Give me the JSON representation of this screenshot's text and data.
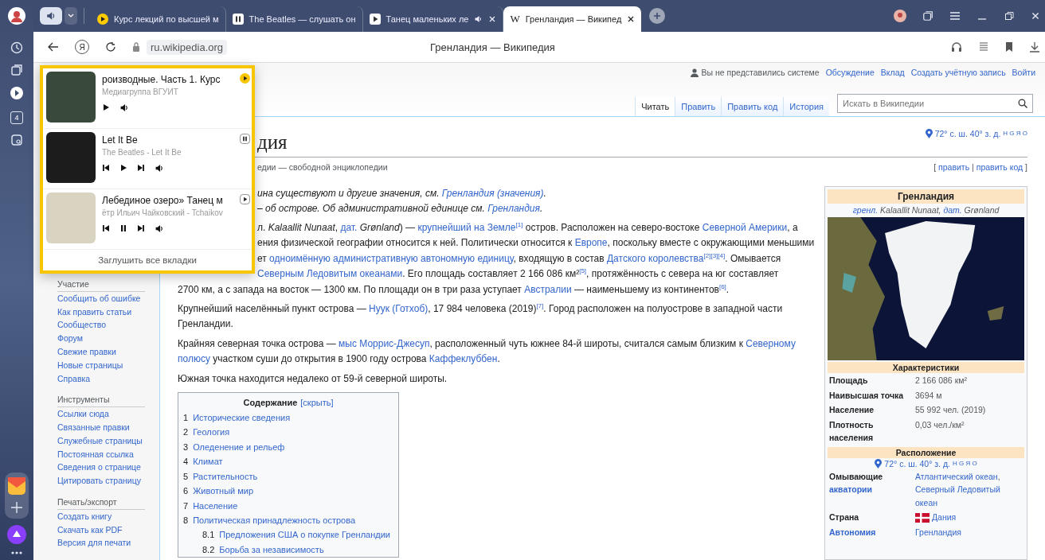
{
  "browser": {
    "tabs": [
      {
        "title": "Курс лекций по высшей м",
        "kind": "video",
        "closable": false,
        "selected": false
      },
      {
        "title": "The Beatles — слушать он",
        "kind": "music",
        "closable": false,
        "selected": false
      },
      {
        "title": "Танец маленьких ле",
        "kind": "sound",
        "closable": true,
        "selected": false
      },
      {
        "title": "Гренландия — Википед",
        "kind": "wiki",
        "favicon_letter": "W",
        "closable": true,
        "selected": true
      }
    ],
    "address": {
      "logo_letter": "Я",
      "url": "ru.wikipedia.org",
      "page_title": "Гренландия — Википедия"
    },
    "rail": {
      "tab_count": "4"
    }
  },
  "wiki": {
    "personal": {
      "user": "Вы не представились системе",
      "links": [
        "Обсуждение",
        "Вклад",
        "Создать учётную запись",
        "Войти"
      ]
    },
    "tabs": [
      {
        "label": "Читать",
        "selected": true
      },
      {
        "label": "Править",
        "selected": false
      },
      {
        "label": "Править код",
        "selected": false
      },
      {
        "label": "История",
        "selected": false
      }
    ],
    "search": {
      "placeholder": "Искать в Википедии"
    },
    "title": "дия",
    "coordinates": {
      "text": "72° с. ш. 40° з. д.",
      "sup": "H G Я O"
    },
    "subtitle": "едии — свободной энциклопедии",
    "edit_links": [
      {
        "text": "[ "
      },
      {
        "text": "править",
        "link": true
      },
      {
        "text": " | "
      },
      {
        "text": "править код",
        "link": true
      },
      {
        "text": " ]"
      }
    ],
    "hatnotes": [
      [
        {
          "text": "ина существуют и другие значения, см. "
        },
        {
          "text": "Гренландия (значения)",
          "link": true
        },
        {
          "text": "."
        }
      ],
      [
        {
          "text": "– об острове. Об административной единице см. "
        },
        {
          "text": "Гренландия",
          "link": true
        },
        {
          "text": "."
        }
      ]
    ],
    "paragraphs": [
      {
        "lines": [
          {
            "fragment": true,
            "segments": [
              {
                "text": "л. *Kalaallit Nunaat*, "
              },
              {
                "text": "дат.",
                "link": true
              },
              {
                "text": " *Grønland*) — "
              },
              {
                "text": "крупнейший на Земле",
                "link": true
              },
              {
                "text": "$^{[1]}$",
                "link": true
              },
              {
                "text": " остров. Расположен на северо-востоке "
              },
              {
                "text": "Северной Америки",
                "link": true
              },
              {
                "text": ", а"
              }
            ]
          },
          {
            "fragment": true,
            "segments": [
              {
                "text": "ения физической географии относится к ней. Политически относится к "
              },
              {
                "text": "Европе",
                "link": true
              },
              {
                "text": ", поскольку вместе с окружающими меньшими"
              }
            ]
          },
          {
            "fragment": true,
            "segments": [
              {
                "text": "ет "
              },
              {
                "text": "одноимённую административную автономную единицу",
                "link": true
              },
              {
                "text": ", входящую в состав "
              },
              {
                "text": "Датского королевства",
                "link": true
              },
              {
                "text": "$^{[2][3][4]}$",
                "link": true
              },
              {
                "text": ". Омывается"
              }
            ]
          },
          {
            "fragment": true,
            "segments": [
              {
                "text": "Северным Ледовитым океанами",
                "link": true
              },
              {
                "text": ". Его площадь составляет 2 166 086 км²"
              },
              {
                "text": "$^{[5]}$",
                "link": true
              },
              {
                "text": ", протяжённость с севера на юг составляет"
              }
            ]
          },
          {
            "fragment": false,
            "segments": [
              {
                "text": "2700 км, а с запада на восток — 1300 км. По площади он в три раза уступает "
              },
              {
                "text": "Австралии",
                "link": true
              },
              {
                "text": " — наименьшему из континентов"
              },
              {
                "text": "$^{[6]}$",
                "link": true
              },
              {
                "text": "."
              }
            ]
          }
        ]
      },
      {
        "lines": [
          {
            "fragment": false,
            "segments": [
              {
                "text": "Крупнейший населённый пункт острова — "
              },
              {
                "text": "Нуук (Готхоб)",
                "link": true
              },
              {
                "text": ", 17 984 человека (2019)"
              },
              {
                "text": "$^{[7]}$",
                "link": true
              },
              {
                "text": ". Город расположен на полуострове в западной части"
              }
            ]
          },
          {
            "fragment": false,
            "segments": [
              {
                "text": "Гренландии."
              }
            ]
          }
        ]
      },
      {
        "lines": [
          {
            "fragment": false,
            "segments": [
              {
                "text": "Крайняя северная точка острова — "
              },
              {
                "text": "мыс Моррис-Джесуп",
                "link": true
              },
              {
                "text": ", расположенный чуть южнее 84-й широты, считался самым близким к "
              },
              {
                "text": "Северному",
                "link": true
              }
            ]
          },
          {
            "fragment": false,
            "segments": [
              {
                "text": "полюсу",
                "link": true
              },
              {
                "text": " участком суши до открытия в 1900 году острова "
              },
              {
                "text": "Каффеклуббен",
                "link": true
              },
              {
                "text": "."
              }
            ]
          }
        ]
      },
      {
        "lines": [
          {
            "fragment": false,
            "segments": [
              {
                "text": "Южная точка находится недалеко от 59-й северной широты."
              }
            ]
          }
        ]
      }
    ],
    "toc": {
      "title": "Содержание",
      "toggle": "[скрыть]",
      "items": [
        {
          "number": "1",
          "text": "Исторические сведения"
        },
        {
          "number": "2",
          "text": "Геология"
        },
        {
          "number": "3",
          "text": "Оледенение и рельеф"
        },
        {
          "number": "4",
          "text": "Климат"
        },
        {
          "number": "5",
          "text": "Растительность"
        },
        {
          "number": "6",
          "text": "Животный мир"
        },
        {
          "number": "7",
          "text": "Население"
        },
        {
          "number": "8",
          "text": "Политическая принадлежность острова",
          "children": [
            {
              "number": "8.1",
              "text": "Предложения США о покупке Гренландии"
            },
            {
              "number": "8.2",
              "text": "Борьба за независимость"
            }
          ]
        }
      ]
    },
    "sidebar": [
      {
        "heading": "Участие",
        "links": [
          "Сообщить об ошибке",
          "Как править статьи",
          "Сообщество",
          "Форум",
          "Свежие правки",
          "Новые страницы",
          "Справка"
        ]
      },
      {
        "heading": "Инструменты",
        "links": [
          "Ссылки сюда",
          "Связанные правки",
          "Служебные страницы",
          "Постоянная ссылка",
          "Сведения о странице",
          "Цитировать страницу"
        ]
      },
      {
        "heading": "Печать/экспорт",
        "links": [
          "Создать книгу",
          "Скачать как PDF",
          "Версия для печати"
        ]
      }
    ],
    "infobox": {
      "title": "Гренландия",
      "subtitle": [
        {
          "text": "гренл.",
          "link": true
        },
        {
          "text": " Kalaallit Nunaat, "
        },
        {
          "text": "дат.",
          "link": true
        },
        {
          "text": " Grønland"
        }
      ],
      "sections": [
        {
          "heading": "Характеристики",
          "rows": [
            {
              "label": [
                {
                  "text": "Площадь"
                }
              ],
              "value": [
                {
                  "text": "2 166 086 км²"
                }
              ],
              "flag": false
            },
            {
              "label": [
                {
                  "text": "Наивысшая точка"
                }
              ],
              "value": [
                {
                  "text": "3694 м"
                }
              ],
              "flag": false
            },
            {
              "label": [
                {
                  "text": "Население"
                }
              ],
              "value": [
                {
                  "text": "55 992 чел. (2019)"
                }
              ],
              "flag": false
            },
            {
              "label": [
                {
                  "text": "Плотность населения"
                }
              ],
              "value": [
                {
                  "text": "0,03 чел./км²"
                }
              ],
              "flag": false
            }
          ]
        },
        {
          "heading": "Расположение",
          "coordinates": {
            "text": "72° с. ш. 40° з. д.",
            "sup": "H G Я O"
          },
          "rows": [
            {
              "label": [
                {
                  "text": "Омывающие "
                },
                {
                  "text": "акватории",
                  "link": true
                }
              ],
              "value": [
                {
                  "text": "Атлантический океан",
                  "link": true
                },
                {
                  "text": ", "
                },
                {
                  "text": "Северный Ледовитый океан",
                  "link": true
                }
              ],
              "flag": false
            },
            {
              "label": [
                {
                  "text": "Страна"
                }
              ],
              "value": [
                {
                  "text": "Дания",
                  "link": true
                }
              ],
              "flag": true
            },
            {
              "label": [
                {
                  "text": "Автономия",
                  "link": true
                }
              ],
              "value": [
                {
                  "text": "Гренландия",
                  "link": true
                }
              ],
              "flag": false
            }
          ]
        }
      ]
    }
  },
  "media_popup": {
    "items": [
      {
        "title": "роизводные. Часть 1. Курс",
        "subtitle": "Медиагруппа ВГУИТ",
        "playing": false,
        "track_nav": false,
        "highlighted": true,
        "paused": false
      },
      {
        "title": "Let It Be",
        "subtitle": "The Beatles - Let It Be",
        "playing": false,
        "track_nav": true,
        "highlighted": false,
        "paused": true
      },
      {
        "title": "Лебединое озеро» Танец м",
        "subtitle": "ётр Ильич Чайковский - Tchaikov",
        "playing": true,
        "track_nav": true,
        "highlighted": false,
        "paused": false
      }
    ],
    "mute_all": "Заглушить все вкладки"
  }
}
